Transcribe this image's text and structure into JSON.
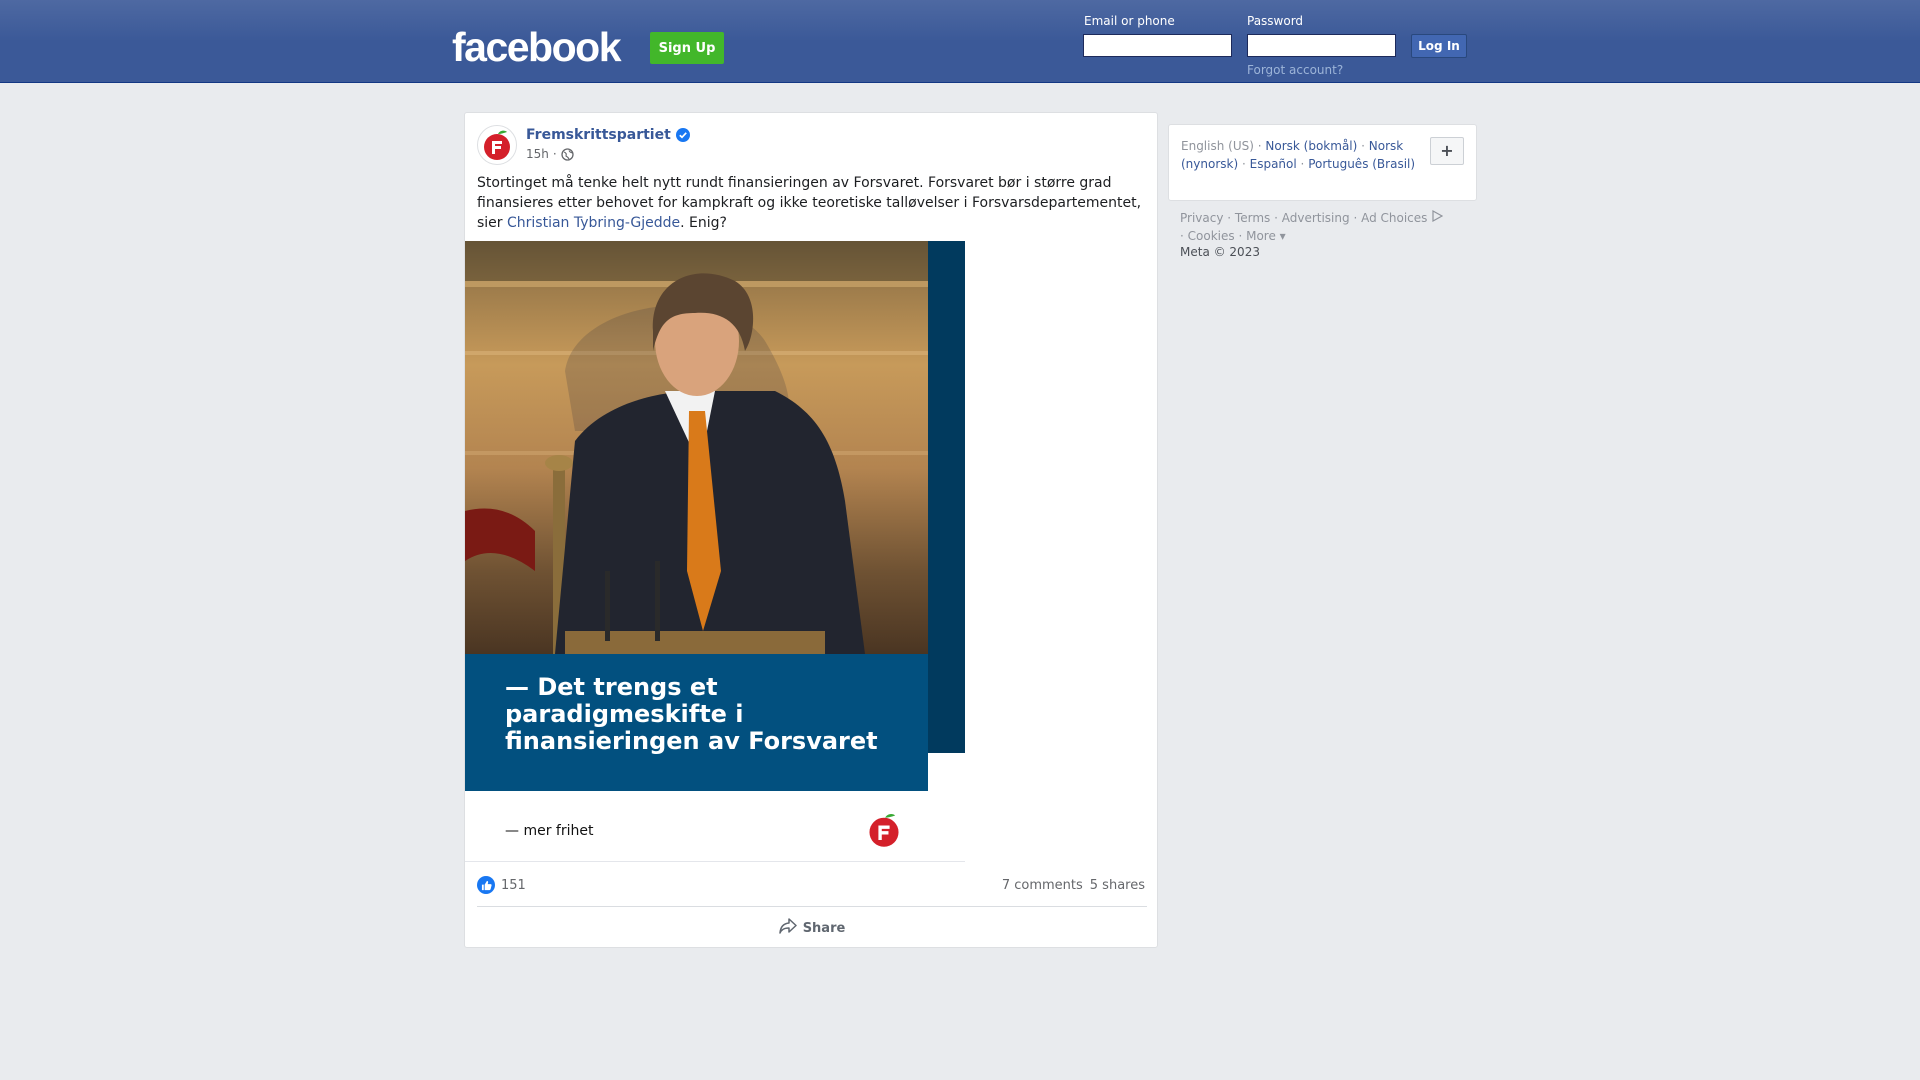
{
  "header": {
    "logo": "facebook",
    "signup_label": "Sign Up",
    "email_label": "Email or phone",
    "email_value": "",
    "password_label": "Password",
    "password_value": "",
    "login_label": "Log In",
    "forgot_label": "Forgot account?"
  },
  "post": {
    "page_name": "Fremskrittspartiet",
    "verified": true,
    "time": "15h",
    "audience_icon": "globe-icon",
    "text_before": "Stortinget må tenke helt nytt rundt finansieringen av Forsvaret. Forsvaret bør i større grad finansieres etter behovet for kampkraft og ikke teoretiske talløvelser i Forsvarsdepartementet, sier ",
    "mention": "Christian Tybring-Gjedde",
    "text_after": ". Enig?",
    "image": {
      "quote": "— Det trengs et paradigmeskifte i finansieringen av Forsvaret",
      "slogan": "— mer frihet",
      "colors": {
        "quote_bg": "#02507f",
        "strip": "#013a5e"
      }
    },
    "likes": "151",
    "comments": "7 comments",
    "shares": "5 shares",
    "share_label": "Share"
  },
  "sidebar": {
    "languages": {
      "current": "English (US)",
      "others": [
        "Norsk (bokmål)",
        "Norsk (nynorsk)",
        "Español",
        "Português (Brasil)"
      ],
      "add_label": "+"
    },
    "footer_links": [
      "Privacy",
      "Terms",
      "Advertising",
      "Ad Choices",
      "Cookies",
      "More"
    ],
    "copyright": "Meta © 2023"
  },
  "colors": {
    "header_bg": "#3b5998",
    "signup_green": "#42b72a",
    "link_blue": "#385898",
    "like_blue": "#1877f2",
    "frp_red": "#d4202a"
  }
}
